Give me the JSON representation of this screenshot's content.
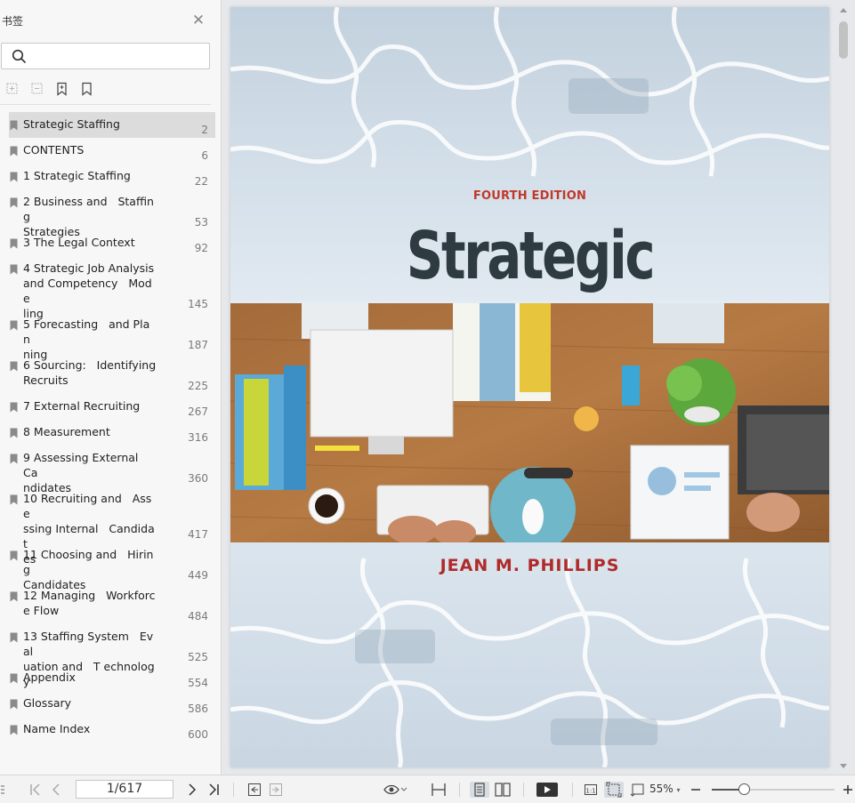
{
  "sidebar": {
    "title": "书签",
    "search": {
      "value": "",
      "placeholder": ""
    },
    "bookmarks": [
      {
        "label": "Strategic Staffing",
        "page": "2",
        "selected": true
      },
      {
        "label": "CONTENTS",
        "page": "6"
      },
      {
        "label": "1 Strategic Staffing",
        "page": "22"
      },
      {
        "label": "2 Business and   Staffing\nStrategies",
        "page": "53"
      },
      {
        "label": "3 The Legal Context",
        "page": "92"
      },
      {
        "label": "4 Strategic Job Analysis\nand Competency   Mode\nling",
        "page": "145"
      },
      {
        "label": "5 Forecasting   and Plan\nning",
        "page": "187"
      },
      {
        "label": "6 Sourcing:   Identifying\nRecruits",
        "page": "225"
      },
      {
        "label": "7 External Recruiting",
        "page": "267"
      },
      {
        "label": "8 Measurement",
        "page": "316"
      },
      {
        "label": "9 Assessing External   Ca\nndidates",
        "page": "360"
      },
      {
        "label": "10 Recruiting and   Asse\nssing Internal   Candidat\nes",
        "page": "417"
      },
      {
        "label": "11 Choosing and   Hiring\nCandidates",
        "page": "449"
      },
      {
        "label": "12 Managing   Workforc\ne Flow",
        "page": "484"
      },
      {
        "label": "13 Staffing System   Eval\nuation and   T echnology",
        "page": "525"
      },
      {
        "label": "Appendix",
        "page": "554"
      },
      {
        "label": "Glossary",
        "page": "586"
      },
      {
        "label": "Name Index",
        "page": "600"
      }
    ]
  },
  "cover": {
    "edition": "FOURTH EDITION",
    "title": "Strategic Staffing",
    "author": "JEAN M. PHILLIPS"
  },
  "statusbar": {
    "page_indicator": "1/617",
    "zoom": "55%",
    "zoom_fraction": 0.27
  },
  "colors": {
    "sidebar_bg": "#f7f7f7",
    "selected_row": "#dcdcdc",
    "edition_red": "#c0392b",
    "title_dark": "#2e3b40",
    "author_red": "#b02a2a"
  }
}
